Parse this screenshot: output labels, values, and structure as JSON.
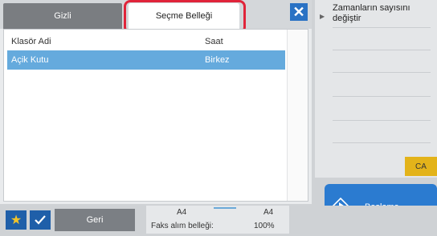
{
  "tabs": {
    "gizli": "Gizli",
    "secme_bellegi": "Seçme Belleği"
  },
  "table": {
    "headers": {
      "folder_name": "Klasör Adi",
      "time": "Saat"
    },
    "rows": [
      {
        "folder_name": "Açik Kutu",
        "time": "Birkez"
      }
    ]
  },
  "side_panel": {
    "title": "Zamanların sayısını değiştir"
  },
  "buttons": {
    "ca": "CA",
    "start": "Baslama",
    "back": "Geri"
  },
  "status": {
    "paper_left": "A4",
    "paper_right": "A4",
    "fax_memory_label": "Faks alım belleği:",
    "fax_memory_value": "100%"
  },
  "colors": {
    "accent": "#2b7bd0",
    "selected_row": "#65aadd",
    "highlight": "#e0243a",
    "ca": "#e3b31a"
  }
}
